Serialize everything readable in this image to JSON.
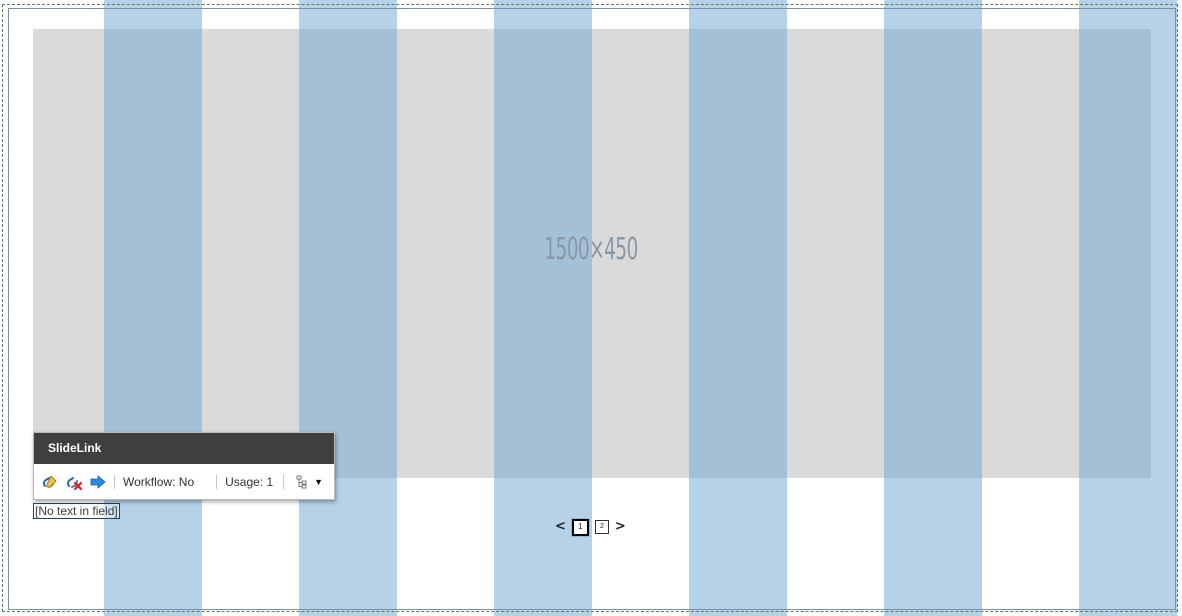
{
  "placeholder": {
    "label": "1500×450"
  },
  "pager": {
    "prev_label": "<",
    "next_label": ">",
    "pages": [
      "1",
      "2"
    ],
    "current_page": "1"
  },
  "empty_field": {
    "text": "[No text in field]"
  },
  "chrome": {
    "title": "SlideLink",
    "edit_icon": "link-edit-icon",
    "remove_icon": "link-remove-icon",
    "navigate_icon": "arrow-right-icon",
    "workflow_label": "Workflow: No",
    "usage_label": "Usage: 1",
    "tree_icon": "tree-icon",
    "caret_icon": "chevron-down-icon"
  },
  "colors": {
    "column_overlay": "#6ea6d4",
    "placeholder_bg": "#dadada",
    "chrome_header": "#3f3f3f"
  }
}
